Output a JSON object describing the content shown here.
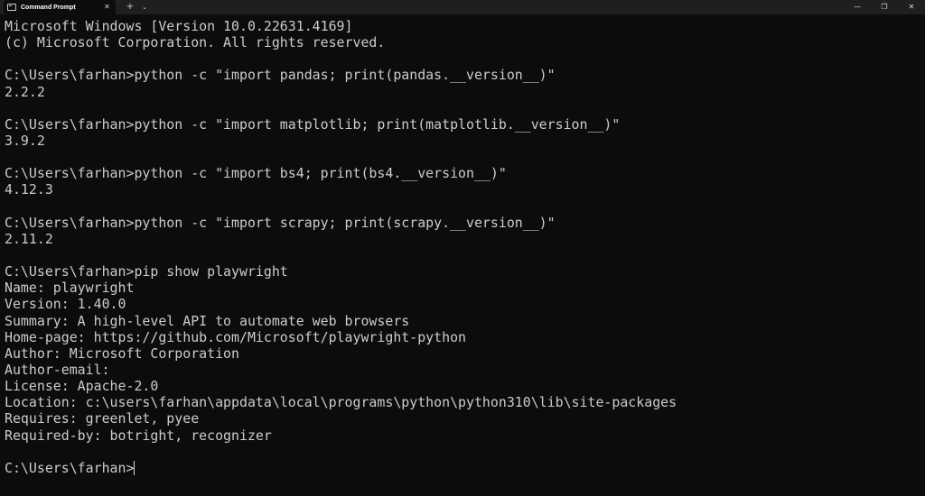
{
  "window": {
    "tab_title": "Command Prompt",
    "tab_icon": "terminal-icon",
    "tab_close": "✕",
    "new_tab": "+",
    "tab_menu": "⌄",
    "minimize": "—",
    "maximize": "❐",
    "close": "✕"
  },
  "colors": {
    "background": "#0c0c0c",
    "titlebar": "#1f1f1f",
    "text": "#cccccc"
  },
  "terminal": {
    "lines": [
      "Microsoft Windows [Version 10.0.22631.4169]",
      "(c) Microsoft Corporation. All rights reserved.",
      "",
      "C:\\Users\\farhan>python -c \"import pandas; print(pandas.__version__)\"",
      "2.2.2",
      "",
      "C:\\Users\\farhan>python -c \"import matplotlib; print(matplotlib.__version__)\"",
      "3.9.2",
      "",
      "C:\\Users\\farhan>python -c \"import bs4; print(bs4.__version__)\"",
      "4.12.3",
      "",
      "C:\\Users\\farhan>python -c \"import scrapy; print(scrapy.__version__)\"",
      "2.11.2",
      "",
      "C:\\Users\\farhan>pip show playwright",
      "Name: playwright",
      "Version: 1.40.0",
      "Summary: A high-level API to automate web browsers",
      "Home-page: https://github.com/Microsoft/playwright-python",
      "Author: Microsoft Corporation",
      "Author-email:",
      "License: Apache-2.0",
      "Location: c:\\users\\farhan\\appdata\\local\\programs\\python\\python310\\lib\\site-packages",
      "Requires: greenlet, pyee",
      "Required-by: botright, recognizer",
      ""
    ],
    "prompt": "C:\\Users\\farhan>"
  }
}
